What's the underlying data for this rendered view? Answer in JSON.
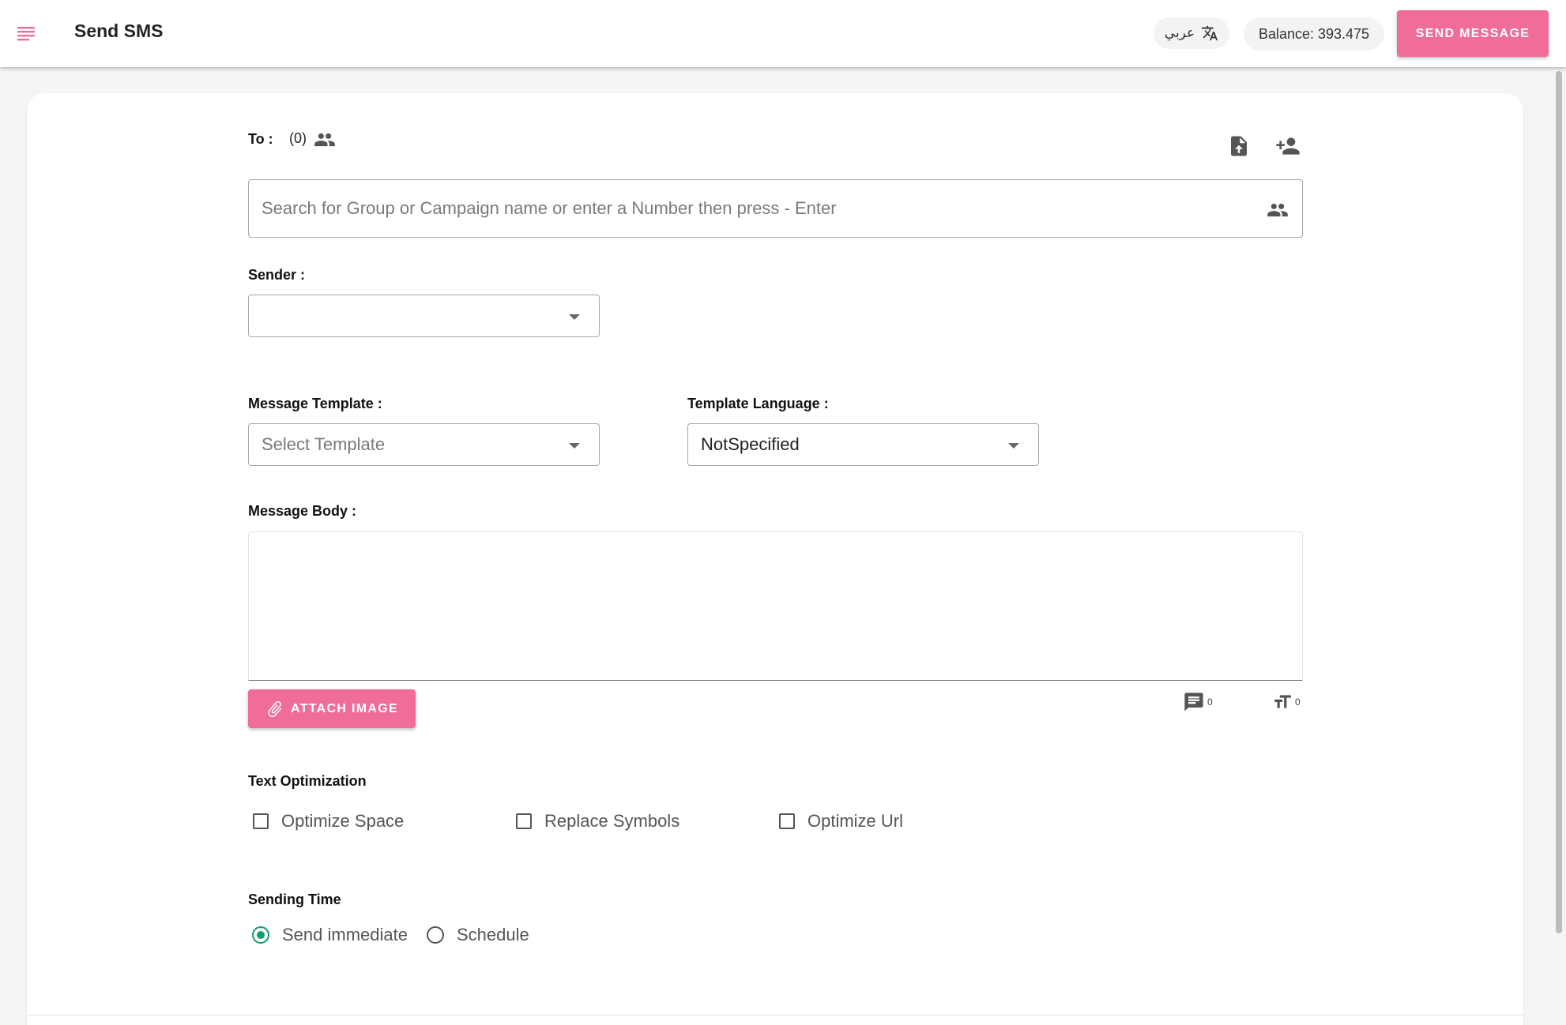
{
  "header": {
    "title": "Send SMS",
    "language_label": "عربي",
    "balance_label": "Balance: 393.475",
    "send_button": "SEND MESSAGE"
  },
  "to": {
    "label": "To :",
    "count": "(0)",
    "search_placeholder": "Search for Group or Campaign name or enter a Number then press - Enter"
  },
  "sender": {
    "label": "Sender :",
    "value": ""
  },
  "template": {
    "label": "Message Template :",
    "placeholder": "Select Template"
  },
  "template_language": {
    "label": "Template Language :",
    "value": "NotSpecified"
  },
  "message_body": {
    "label": "Message Body :",
    "value": "",
    "attach_button": "ATTACH IMAGE",
    "message_count": "0",
    "char_count": "0"
  },
  "text_optimization": {
    "label": "Text Optimization",
    "options": [
      "Optimize Space",
      "Replace Symbols",
      "Optimize Url"
    ]
  },
  "sending_time": {
    "label": "Sending Time",
    "options": [
      "Send immediate",
      "Schedule"
    ],
    "selected": "Send immediate"
  },
  "colors": {
    "accent": "#f06c9b",
    "radio_selected": "#0f9d72"
  },
  "icons": {
    "menu": "menu-icon",
    "translate": "translate-icon",
    "group": "group-icon",
    "upload_file": "upload-file-icon",
    "add_contact": "add-person-icon",
    "attach": "paperclip-icon",
    "sms_count": "chat-bubble-icon",
    "char_count": "text-size-icon"
  }
}
